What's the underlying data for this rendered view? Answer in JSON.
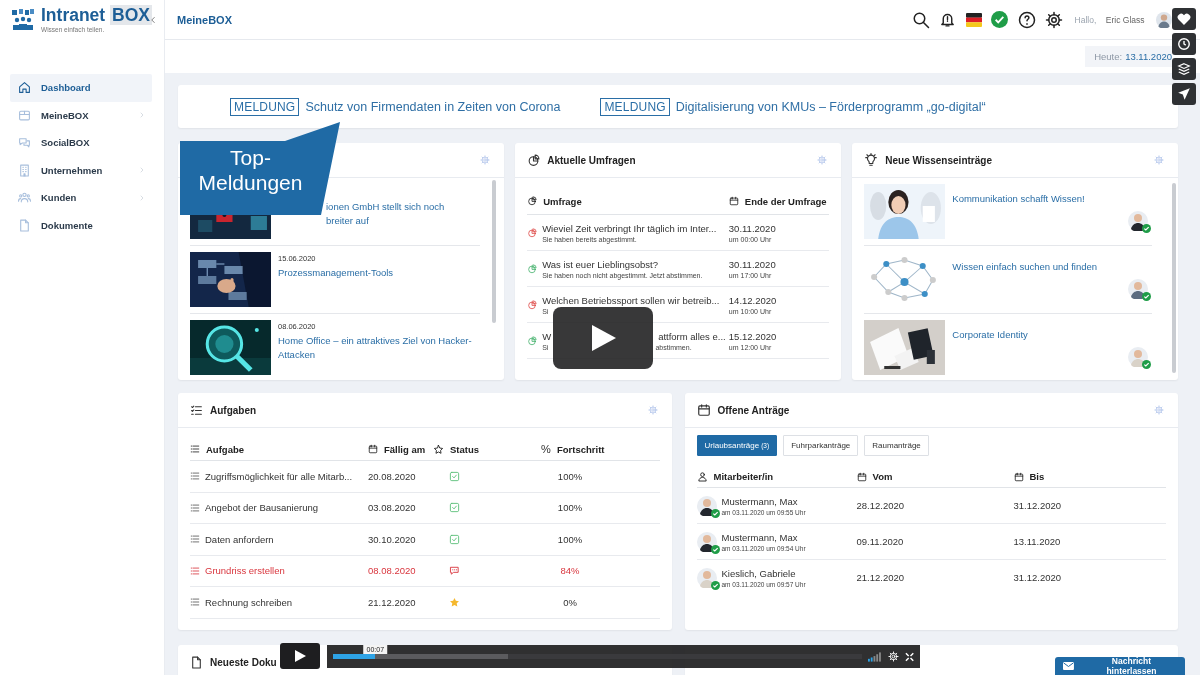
{
  "sidebar": {
    "brand": "Intranet",
    "brand_highlight": "BOX",
    "tagline": "Wissen einfach teilen.",
    "items": [
      {
        "label": "Dashboard",
        "selected": true,
        "submenu": false
      },
      {
        "label": "MeineBOX",
        "selected": false,
        "submenu": true
      },
      {
        "label": "SocialBOX",
        "selected": false,
        "submenu": false
      },
      {
        "label": "Unternehmen",
        "selected": false,
        "submenu": true
      },
      {
        "label": "Kunden",
        "selected": false,
        "submenu": true
      },
      {
        "label": "Dokumente",
        "selected": false,
        "submenu": false
      }
    ]
  },
  "header": {
    "title": "MeineBOX",
    "greeting": "Hallo,",
    "user": "Eric Glass"
  },
  "date": {
    "label": "Heute:",
    "value": "13.11.2020"
  },
  "ticker": [
    {
      "tag": "MELDUNG",
      "text": "Schutz von Firmendaten in Zeiten von Corona"
    },
    {
      "tag": "MELDUNG",
      "text": "Digitalisierung von KMUs – Förderprogramm „go-digital“"
    }
  ],
  "callout": "Top-Meldungen",
  "news": {
    "items": [
      {
        "title": "ionen GmbH stellt sich noch breiter auf"
      },
      {
        "date": "15.06.2020",
        "title": "Prozessmanagement-Tools"
      },
      {
        "date": "08.06.2020",
        "title": "Home Office – ein attraktives Ziel von Hacker-Attacken"
      }
    ]
  },
  "surveys": {
    "title": "Aktuelle Umfragen",
    "columns": [
      "Umfrage",
      "Ende der Umfrage"
    ],
    "rows": [
      {
        "question": [
          "Wieviel Zeit verbringt Ihr täglich im Inter..."
        ],
        "note": [
          "Sie haben bereits abgestimmt."
        ],
        "voted": true,
        "date": "30.11.2020",
        "time": "um 00:00 Uhr"
      },
      {
        "question": [
          "Was ist euer Lieblingsobst?"
        ],
        "note": [
          "Sie haben noch nicht abgestimmt. Jetzt abstimmen."
        ],
        "voted": false,
        "date": "30.11.2020",
        "time": "um 17:00 Uhr"
      },
      {
        "question": [
          "Welchen Betriebssport sollen wir betreib..."
        ],
        "note": [
          "Si"
        ],
        "voted": true,
        "date": "14.12.2020",
        "time": "um 10:00 Uhr"
      },
      {
        "question": [
          "W",
          "attform alles e..."
        ],
        "note": [
          "Si",
          "abstimmen."
        ],
        "voted": false,
        "date": "15.12.2020",
        "time": "um 12:00 Uhr"
      }
    ]
  },
  "knowledge": {
    "title": "Neue Wissenseinträge",
    "items": [
      {
        "title": "Kommunikation schafft Wissen!"
      },
      {
        "title": "Wissen einfach suchen und finden"
      },
      {
        "title": "Corporate Identity"
      }
    ]
  },
  "tasks": {
    "title": "Aufgaben",
    "columns": [
      "Aufgabe",
      "Fällig am",
      "Status",
      "Fortschritt"
    ],
    "progress_symbol": "%",
    "rows": [
      {
        "task": "Zugriffsmöglichkeit für alle Mitarb...",
        "due": "20.08.2020",
        "kind": "done",
        "progress": "100%",
        "overdue": false
      },
      {
        "task": "Angebot der Bausanierung",
        "due": "03.08.2020",
        "kind": "done",
        "progress": "100%",
        "overdue": false
      },
      {
        "task": "Daten anfordern",
        "due": "30.10.2020",
        "kind": "done",
        "progress": "100%",
        "overdue": false
      },
      {
        "task": "Grundriss erstellen",
        "due": "08.08.2020",
        "kind": "comment",
        "progress": "84%",
        "overdue": true
      },
      {
        "task": "Rechnung schreiben",
        "due": "21.12.2020",
        "kind": "star",
        "progress": "0%",
        "overdue": false
      }
    ]
  },
  "requests": {
    "title": "Offene Anträge",
    "tabs": [
      {
        "label": "Urlaubsanträge",
        "count": "(3)",
        "selected": true
      },
      {
        "label": "Fuhrparkanträge",
        "selected": false
      },
      {
        "label": "Raumanträge",
        "selected": false
      }
    ],
    "columns": [
      "Mitarbeiter/in",
      "Vom",
      "Bis"
    ],
    "rows": [
      {
        "name": "Mustermann, Max",
        "submitted": "am 03.11.2020 um 09:55 Uhr",
        "from": "28.12.2020",
        "to": "31.12.2020"
      },
      {
        "name": "Mustermann, Max",
        "submitted": "am 03.11.2020 um 09:54 Uhr",
        "from": "09.11.2020",
        "to": "13.11.2020"
      },
      {
        "name": "Kieslich, Gabriele",
        "submitted": "am 03.11.2020 um 09:57 Uhr",
        "from": "21.12.2020",
        "to": "31.12.2020"
      }
    ]
  },
  "documents": {
    "title": "Neueste Doku"
  },
  "video": {
    "time": "00:07",
    "progress": {
      "level": 0.08
    },
    "buffer": {
      "level": 0.33
    }
  },
  "message_button": "Nachricht hinterlassen"
}
